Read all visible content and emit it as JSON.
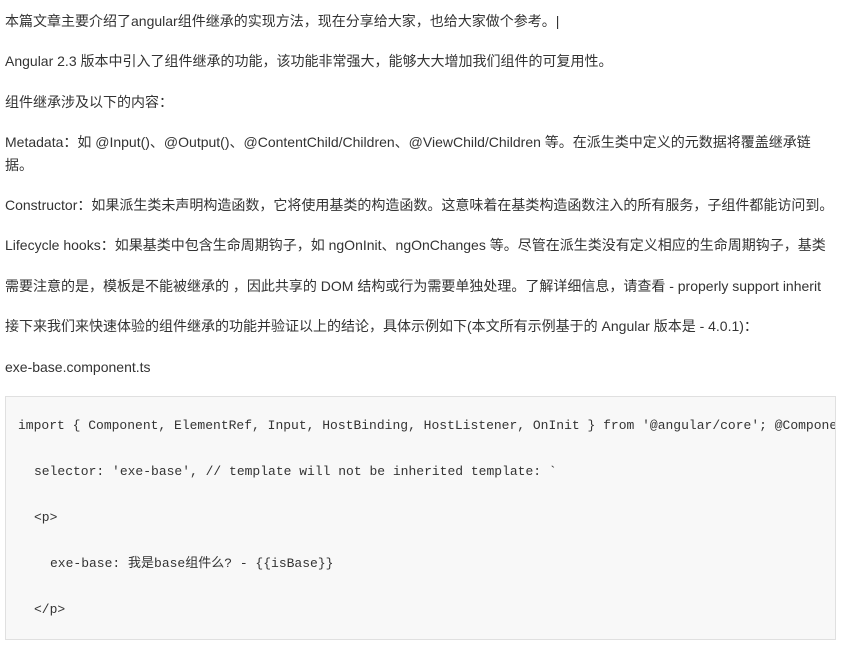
{
  "paragraphs": {
    "intro": "本篇文章主要介绍了angular组件继承的实现方法，现在分享给大家，也给大家做个参考。",
    "version": "Angular 2.3 版本中引入了组件继承的功能，该功能非常强大，能够大大增加我们组件的可复用性。",
    "involves": "组件继承涉及以下的内容：",
    "metadata": "Metadata：如 @Input()、@Output()、@ContentChild/Children、@ViewChild/Children 等。在派生类中定义的元数据将覆盖继承链据。",
    "constructor": "Constructor：如果派生类未声明构造函数，它将使用基类的构造函数。这意味着在基类构造函数注入的所有服务，子组件都能访问到。",
    "lifecycle": "Lifecycle hooks：如果基类中包含生命周期钩子，如 ngOnInit、ngOnChanges 等。尽管在派生类没有定义相应的生命周期钩子，基类",
    "note": "需要注意的是，模板是不能被继承的 ，因此共享的 DOM 结构或行为需要单独处理。了解详细信息，请查看 - properly support inherit",
    "next": "接下来我们来快速体验的组件继承的功能并验证以上的结论，具体示例如下(本文所有示例基于的 Angular 版本是 - 4.0.1)：",
    "filename": "exe-base.component.ts"
  },
  "code": {
    "line1": "import { Component, ElementRef, Input, HostBinding, HostListener, OnInit } from '@angular/core'; @Component({",
    "line2": "selector: 'exe-base', // template will not be inherited template: `",
    "line3": "<p>",
    "line4": "exe-base: 我是base组件么? - {{isBase}}",
    "line5": "</p>"
  }
}
